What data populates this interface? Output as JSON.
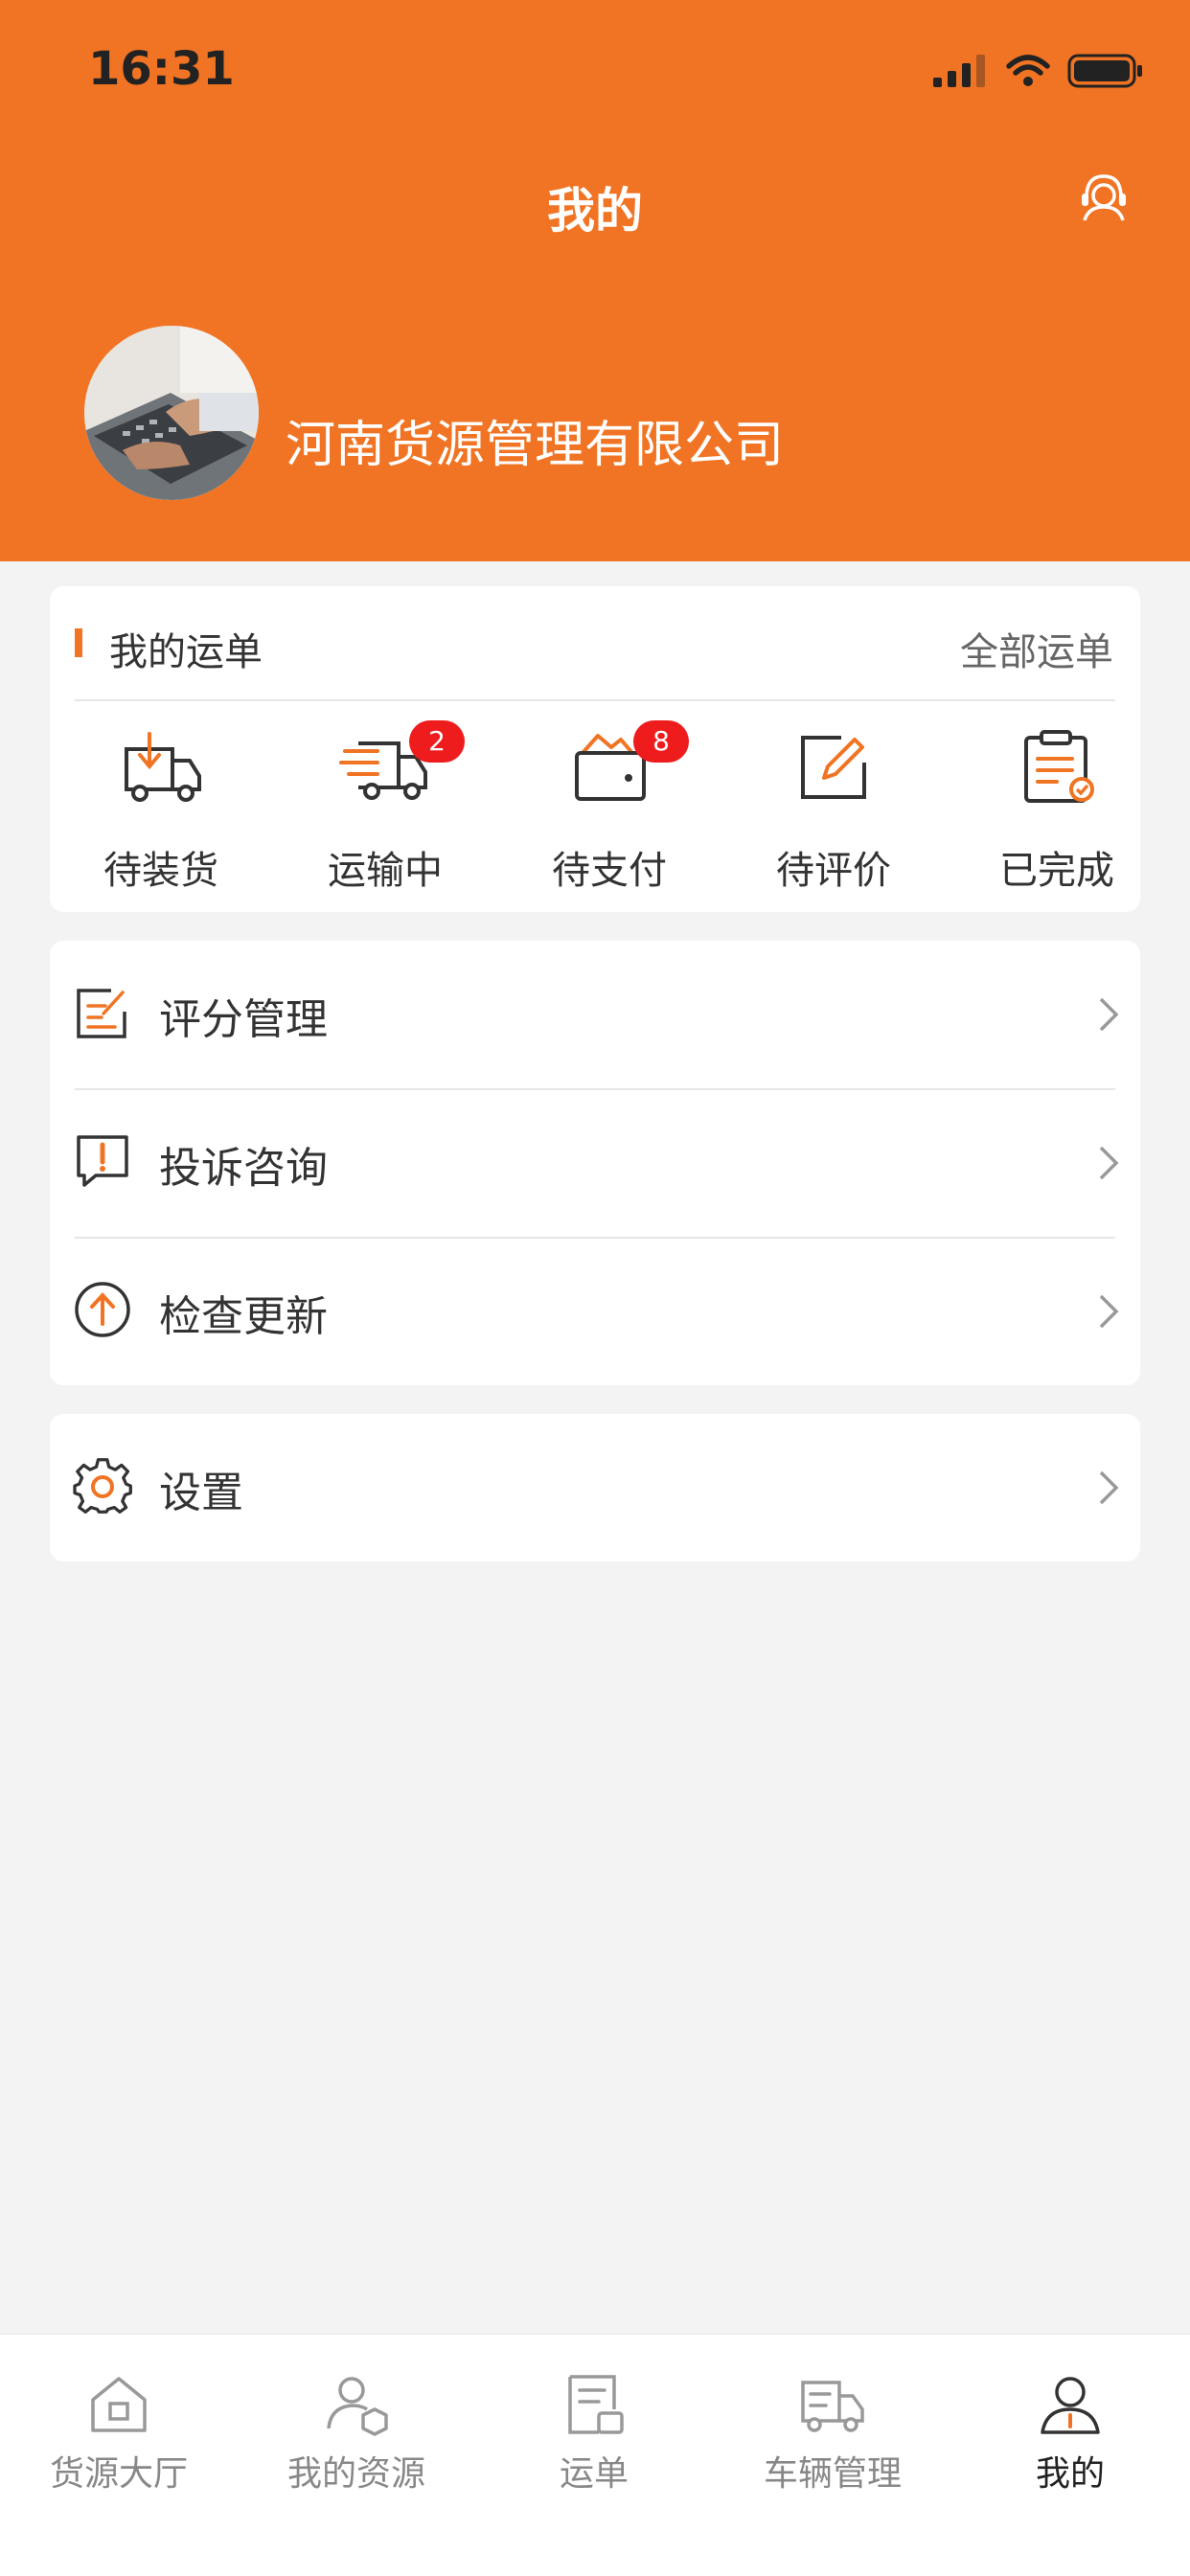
{
  "status": {
    "time": "16:31"
  },
  "header": {
    "title": "我的",
    "support_icon": "headset-icon"
  },
  "profile": {
    "company": "河南货源管理有限公司",
    "avatar": "avatar-photo-laptop"
  },
  "orders": {
    "title": "我的运单",
    "all_label": "全部运单",
    "items": [
      {
        "label": "待装货",
        "icon": "loading-truck-icon",
        "badge": ""
      },
      {
        "label": "运输中",
        "icon": "moving-truck-icon",
        "badge": "2"
      },
      {
        "label": "待支付",
        "icon": "wallet-icon",
        "badge": "8"
      },
      {
        "label": "待评价",
        "icon": "edit-note-icon",
        "badge": ""
      },
      {
        "label": "已完成",
        "icon": "completed-clipboard-icon",
        "badge": ""
      }
    ]
  },
  "menu": {
    "items": [
      {
        "label": "评分管理",
        "icon": "rating-edit-icon"
      },
      {
        "label": "投诉咨询",
        "icon": "complaint-chat-icon"
      },
      {
        "label": "检查更新",
        "icon": "upload-arrow-icon"
      }
    ],
    "settings": {
      "label": "设置",
      "icon": "gear-icon"
    }
  },
  "tabbar": {
    "active_index": 4,
    "items": [
      {
        "label": "货源大厅",
        "icon": "home-icon"
      },
      {
        "label": "我的资源",
        "icon": "user-box-icon"
      },
      {
        "label": "运单",
        "icon": "order-doc-icon"
      },
      {
        "label": "车辆管理",
        "icon": "truck-icon"
      },
      {
        "label": "我的",
        "icon": "person-icon"
      }
    ]
  },
  "colors": {
    "brand": "#f07424",
    "badge": "#ee1c1c",
    "background": "#f3f3f3"
  }
}
